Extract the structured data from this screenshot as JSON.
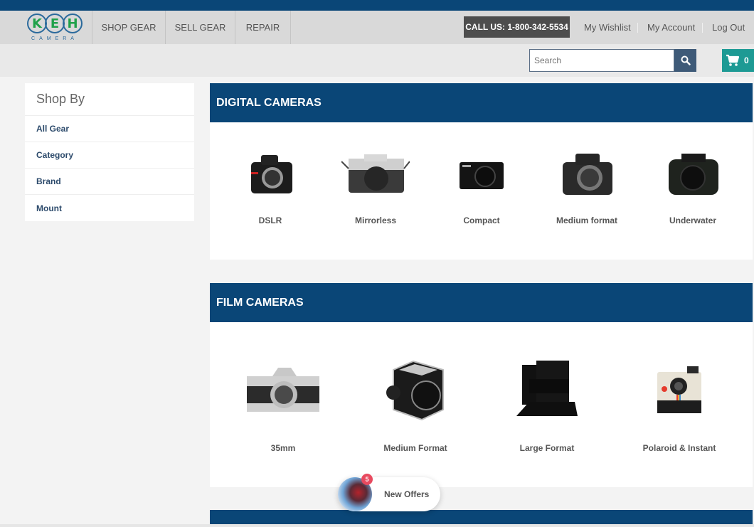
{
  "header": {
    "logo_letters": [
      "K",
      "E",
      "H"
    ],
    "logo_sub": "CAMERA",
    "nav": [
      {
        "label": "SHOP GEAR"
      },
      {
        "label": "SELL GEAR"
      },
      {
        "label": "REPAIR"
      }
    ],
    "call_us": "CALL US: 1-800-342-5534",
    "links": [
      {
        "label": "My Wishlist"
      },
      {
        "label": "My Account"
      },
      {
        "label": "Log Out"
      }
    ]
  },
  "search": {
    "placeholder": "Search",
    "value": "",
    "icon": "search-icon"
  },
  "cart": {
    "icon": "cart-icon",
    "count": "0"
  },
  "sidebar": {
    "title": "Shop By",
    "items": [
      {
        "label": "All Gear"
      },
      {
        "label": "Category"
      },
      {
        "label": "Brand"
      },
      {
        "label": "Mount"
      }
    ]
  },
  "sections": {
    "digital": {
      "title": "DIGITAL CAMERAS",
      "items": [
        {
          "label": "DSLR",
          "icon": "dslr-camera-image"
        },
        {
          "label": "Mirrorless",
          "icon": "mirrorless-camera-image"
        },
        {
          "label": "Compact",
          "icon": "compact-camera-image"
        },
        {
          "label": "Medium format",
          "icon": "medium-format-camera-image"
        },
        {
          "label": "Underwater",
          "icon": "underwater-camera-image"
        }
      ]
    },
    "film": {
      "title": "FILM CAMERAS",
      "items": [
        {
          "label": "35mm",
          "icon": "35mm-camera-image"
        },
        {
          "label": "Medium Format",
          "icon": "medium-format-film-camera-image"
        },
        {
          "label": "Large Format",
          "icon": "large-format-camera-image"
        },
        {
          "label": "Polaroid & Instant",
          "icon": "polaroid-camera-image"
        }
      ]
    }
  },
  "offers": {
    "label": "New Offers",
    "badge": "5"
  },
  "colors": {
    "brand_navy": "#0a4677",
    "cart_teal": "#1d9a94",
    "logo_green": "#1fa14a",
    "search_btn": "#3e5a78"
  }
}
